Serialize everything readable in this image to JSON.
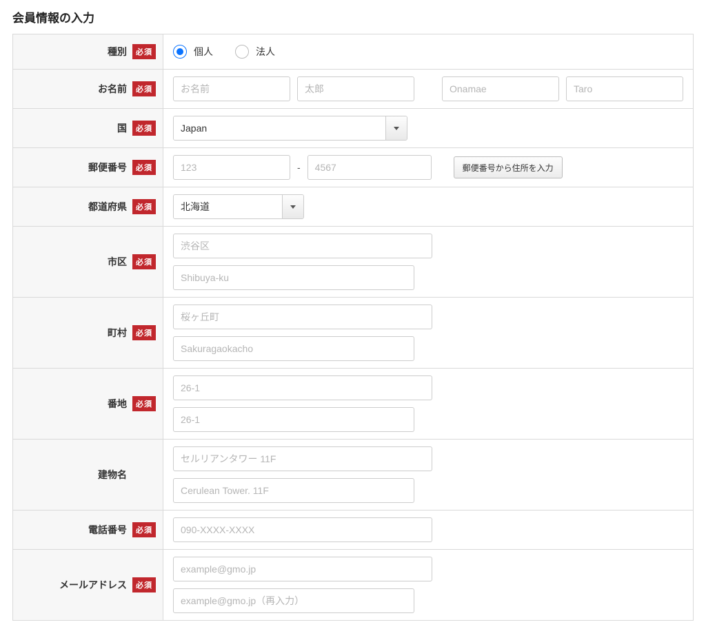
{
  "title": "会員情報の入力",
  "required_label": "必須",
  "rows": {
    "type": {
      "label": "種別",
      "required": true,
      "options": {
        "individual": "個人",
        "corporate": "法人"
      },
      "selected": "individual"
    },
    "name": {
      "label": "お名前",
      "required": true,
      "placeholders": {
        "sei_jp": "お名前",
        "mei_jp": "太郎",
        "sei_en": "Onamae",
        "mei_en": "Taro"
      }
    },
    "country": {
      "label": "国",
      "required": true,
      "value": "Japan"
    },
    "postal": {
      "label": "郵便番号",
      "required": true,
      "placeholder1": "123",
      "placeholder2": "4567",
      "button": "郵便番号から住所を入力"
    },
    "prefecture": {
      "label": "都道府県",
      "required": true,
      "value": "北海道"
    },
    "city": {
      "label": "市区",
      "required": true,
      "placeholder_jp": "渋谷区",
      "placeholder_en": "Shibuya-ku"
    },
    "town": {
      "label": "町村",
      "required": true,
      "placeholder_jp": "桜ヶ丘町",
      "placeholder_en": "Sakuragaokacho"
    },
    "street": {
      "label": "番地",
      "required": true,
      "placeholder_jp": "26-1",
      "placeholder_en": "26-1"
    },
    "building": {
      "label": "建物名",
      "required": false,
      "placeholder_jp": "セルリアンタワー 11F",
      "placeholder_en": "Cerulean Tower. 11F"
    },
    "phone": {
      "label": "電話番号",
      "required": true,
      "placeholder": "090-XXXX-XXXX"
    },
    "email": {
      "label": "メールアドレス",
      "required": true,
      "placeholder1": "example@gmo.jp",
      "placeholder2": "example@gmo.jp（再入力）"
    }
  }
}
